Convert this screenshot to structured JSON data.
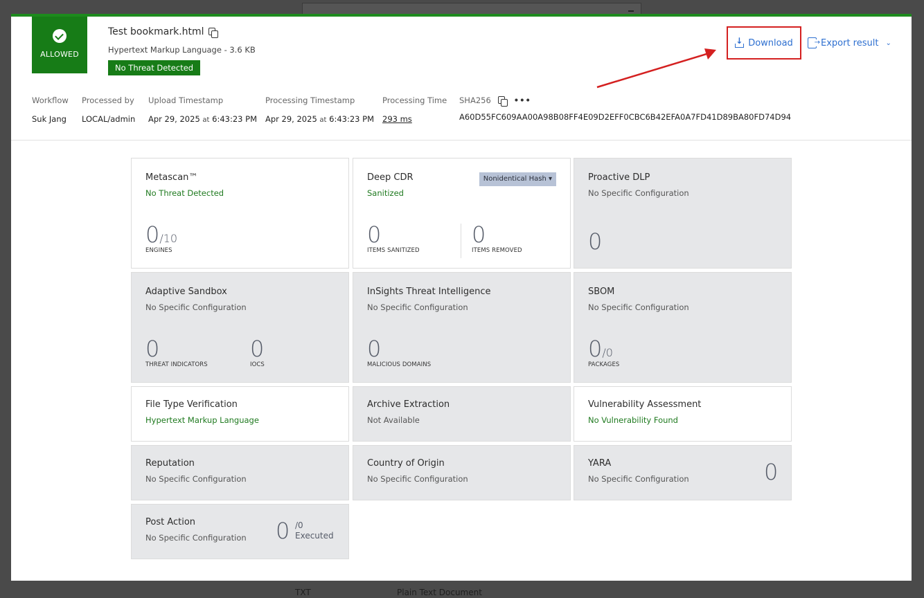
{
  "file": {
    "verdict": "ALLOWED",
    "name": "Test bookmark.html",
    "type_size": "Hypertext Markup Language - 3.6 KB",
    "threat_badge": "No Threat Detected"
  },
  "actions": {
    "download": "Download",
    "export": "Export result"
  },
  "meta": {
    "workflow": {
      "label": "Workflow",
      "value": "Suk Jang"
    },
    "processed_by": {
      "label": "Processed by",
      "value": "LOCAL/admin"
    },
    "upload": {
      "label": "Upload Timestamp",
      "date": "Apr 29, 2025",
      "at": "at",
      "time": "6:43:23 PM"
    },
    "processing": {
      "label": "Processing Timestamp",
      "date": "Apr 29, 2025",
      "at": "at",
      "time": "6:43:23 PM"
    },
    "processing_time": {
      "label": "Processing Time",
      "value": "293 ms"
    },
    "sha": {
      "label": "SHA256",
      "value": "A60D55FC609AA00A98B08FF4E09D2EFF0CBC6B42EFA0A7FD41D89BA80FD74D94",
      "more": "•••"
    }
  },
  "cards": {
    "metascan": {
      "title": "Metascan™",
      "status": "No Threat Detected",
      "value": "0",
      "of": "/10",
      "caption": "ENGINES"
    },
    "cdr": {
      "title": "Deep CDR",
      "status": "Sanitized",
      "hash_option": "Nonidentical Hash",
      "sanitized": "0",
      "sanitized_caption": "ITEMS SANITIZED",
      "removed": "0",
      "removed_caption": "ITEMS REMOVED"
    },
    "dlp": {
      "title": "Proactive DLP",
      "status": "No Specific Configuration",
      "value": "0"
    },
    "sandbox": {
      "title": "Adaptive Sandbox",
      "status": "No Specific Configuration",
      "threat": "0",
      "threat_caption": "THREAT INDICATORS",
      "iocs": "0",
      "iocs_caption": "IOCS"
    },
    "insights": {
      "title": "InSights Threat Intelligence",
      "status": "No Specific Configuration",
      "value": "0",
      "caption": "MALICIOUS DOMAINS"
    },
    "sbom": {
      "title": "SBOM",
      "status": "No Specific Configuration",
      "value": "0",
      "of": "/0",
      "caption": "PACKAGES"
    },
    "filetype": {
      "title": "File Type Verification",
      "status": "Hypertext Markup Language"
    },
    "archive": {
      "title": "Archive Extraction",
      "status": "Not Available"
    },
    "vuln": {
      "title": "Vulnerability Assessment",
      "status": "No Vulnerability Found"
    },
    "reputation": {
      "title": "Reputation",
      "status": "No Specific Configuration"
    },
    "country": {
      "title": "Country of Origin",
      "status": "No Specific Configuration"
    },
    "yara": {
      "title": "YARA",
      "status": "No Specific Configuration",
      "value": "0"
    },
    "post": {
      "title": "Post Action",
      "status": "No Specific Configuration",
      "value": "0",
      "of": "/0",
      "executed": "Executed"
    }
  },
  "background": {
    "row_ext": "TXT",
    "row_type": "Plain Text Document"
  },
  "colors": {
    "allowed": "#177c17",
    "link": "#2d6fd0",
    "highlight": "#d42020"
  }
}
